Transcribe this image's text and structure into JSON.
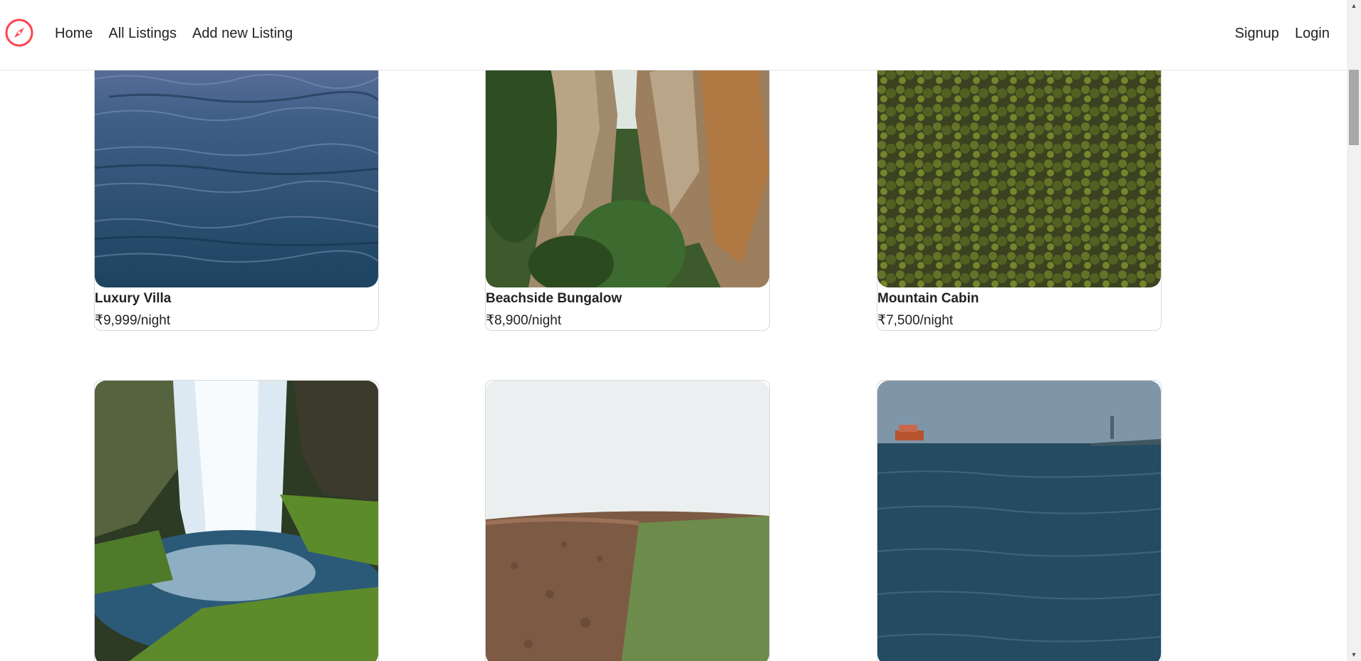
{
  "nav": {
    "links": [
      "Home",
      "All Listings",
      "Add new Listing"
    ],
    "auth": [
      "Signup",
      "Login"
    ]
  },
  "brand": {
    "accent_color": "#fe424d",
    "logo_icon": "compass-icon"
  },
  "listings": [
    {
      "title": "Luxury Villa",
      "price": "₹9,999/night",
      "image": "ocean-waves"
    },
    {
      "title": "Beachside Bungalow",
      "price": "₹8,900/night",
      "image": "rock-cliffs"
    },
    {
      "title": "Mountain Cabin",
      "price": "₹7,500/night",
      "image": "forest-aerial"
    },
    {
      "title": "",
      "price": "",
      "image": "waterfall"
    },
    {
      "title": "",
      "price": "",
      "image": "farm-field"
    },
    {
      "title": "",
      "price": "",
      "image": "sea-ferry"
    }
  ]
}
